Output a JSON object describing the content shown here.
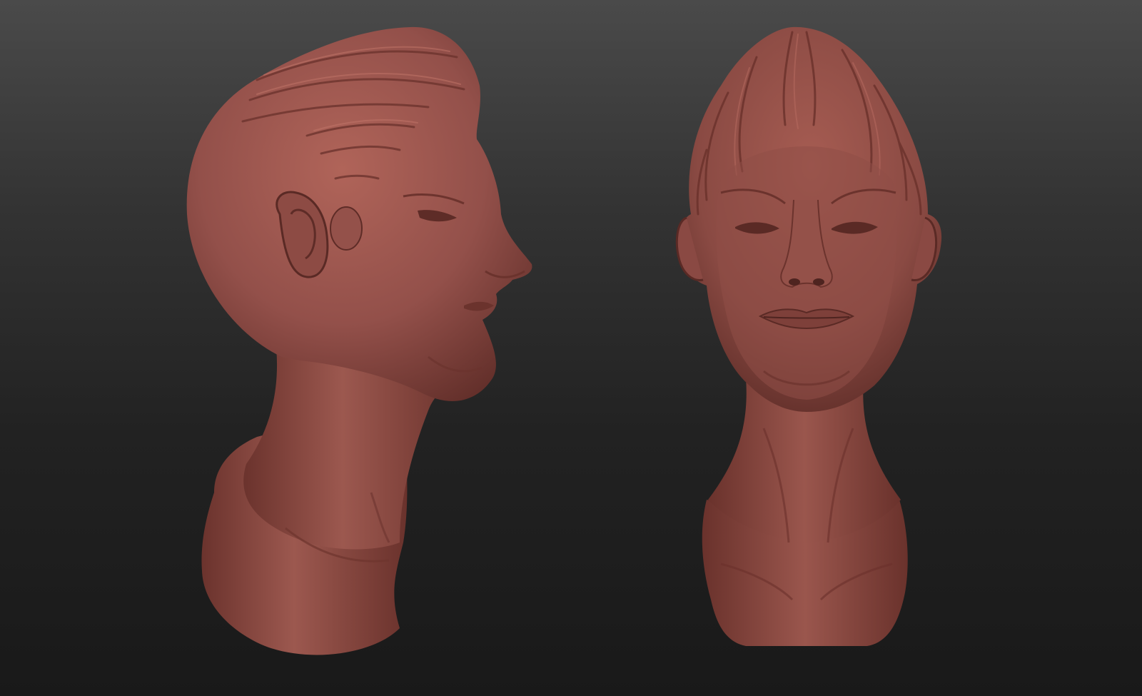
{
  "scene": {
    "background_top": "#4a4a4a",
    "background_bottom": "#191919",
    "clay_color": "#9a554c",
    "clay_shadow": "#5a2a25",
    "clay_highlight": "#b56a5f"
  },
  "models": [
    {
      "view": "profile",
      "icon": "sculpt-bust-profile"
    },
    {
      "view": "front",
      "icon": "sculpt-bust-front"
    }
  ]
}
